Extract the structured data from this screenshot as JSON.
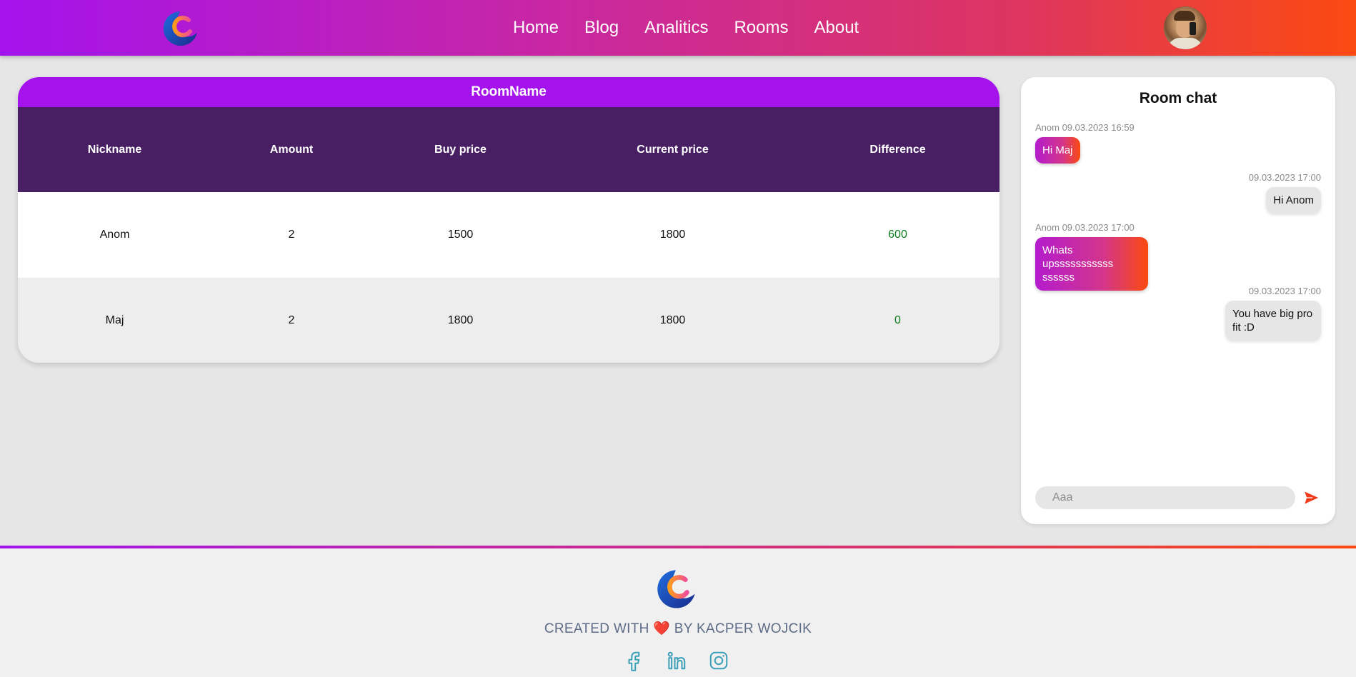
{
  "header": {
    "nav": [
      "Home",
      "Blog",
      "Analitics",
      "Rooms",
      "About"
    ]
  },
  "room": {
    "name": "RoomName",
    "columns": [
      "Nickname",
      "Amount",
      "Buy price",
      "Current price",
      "Difference"
    ],
    "rows": [
      [
        "Anom",
        "2",
        "1500",
        "1800",
        "600"
      ],
      [
        "Maj",
        "2",
        "1800",
        "1800",
        "0"
      ]
    ]
  },
  "chat": {
    "title": "Room chat",
    "messages": [
      {
        "meta": "Anom 09.03.2023 16:59",
        "text": "Hi Maj",
        "direction": "in"
      },
      {
        "meta": "09.03.2023 17:00",
        "text": "Hi Anom",
        "direction": "out"
      },
      {
        "meta": "Anom 09.03.2023 17:00",
        "text": "Whats upsssssssssss ssssss",
        "direction": "in"
      },
      {
        "meta": "09.03.2023 17:00",
        "text": "You have big pro fit :D",
        "direction": "out"
      }
    ],
    "input_placeholder": "Aaa"
  },
  "footer": {
    "credit_before": "CREATED WITH",
    "credit_after": "BY KACPER WOJCIK",
    "socials": [
      "facebook-icon",
      "linkedin-icon",
      "instagram-icon"
    ]
  },
  "colors": {
    "brand_purple": "#a413ec",
    "brand_orange": "#fb4a10",
    "table_header": "#481f63",
    "positive": "#0a7a1a"
  }
}
